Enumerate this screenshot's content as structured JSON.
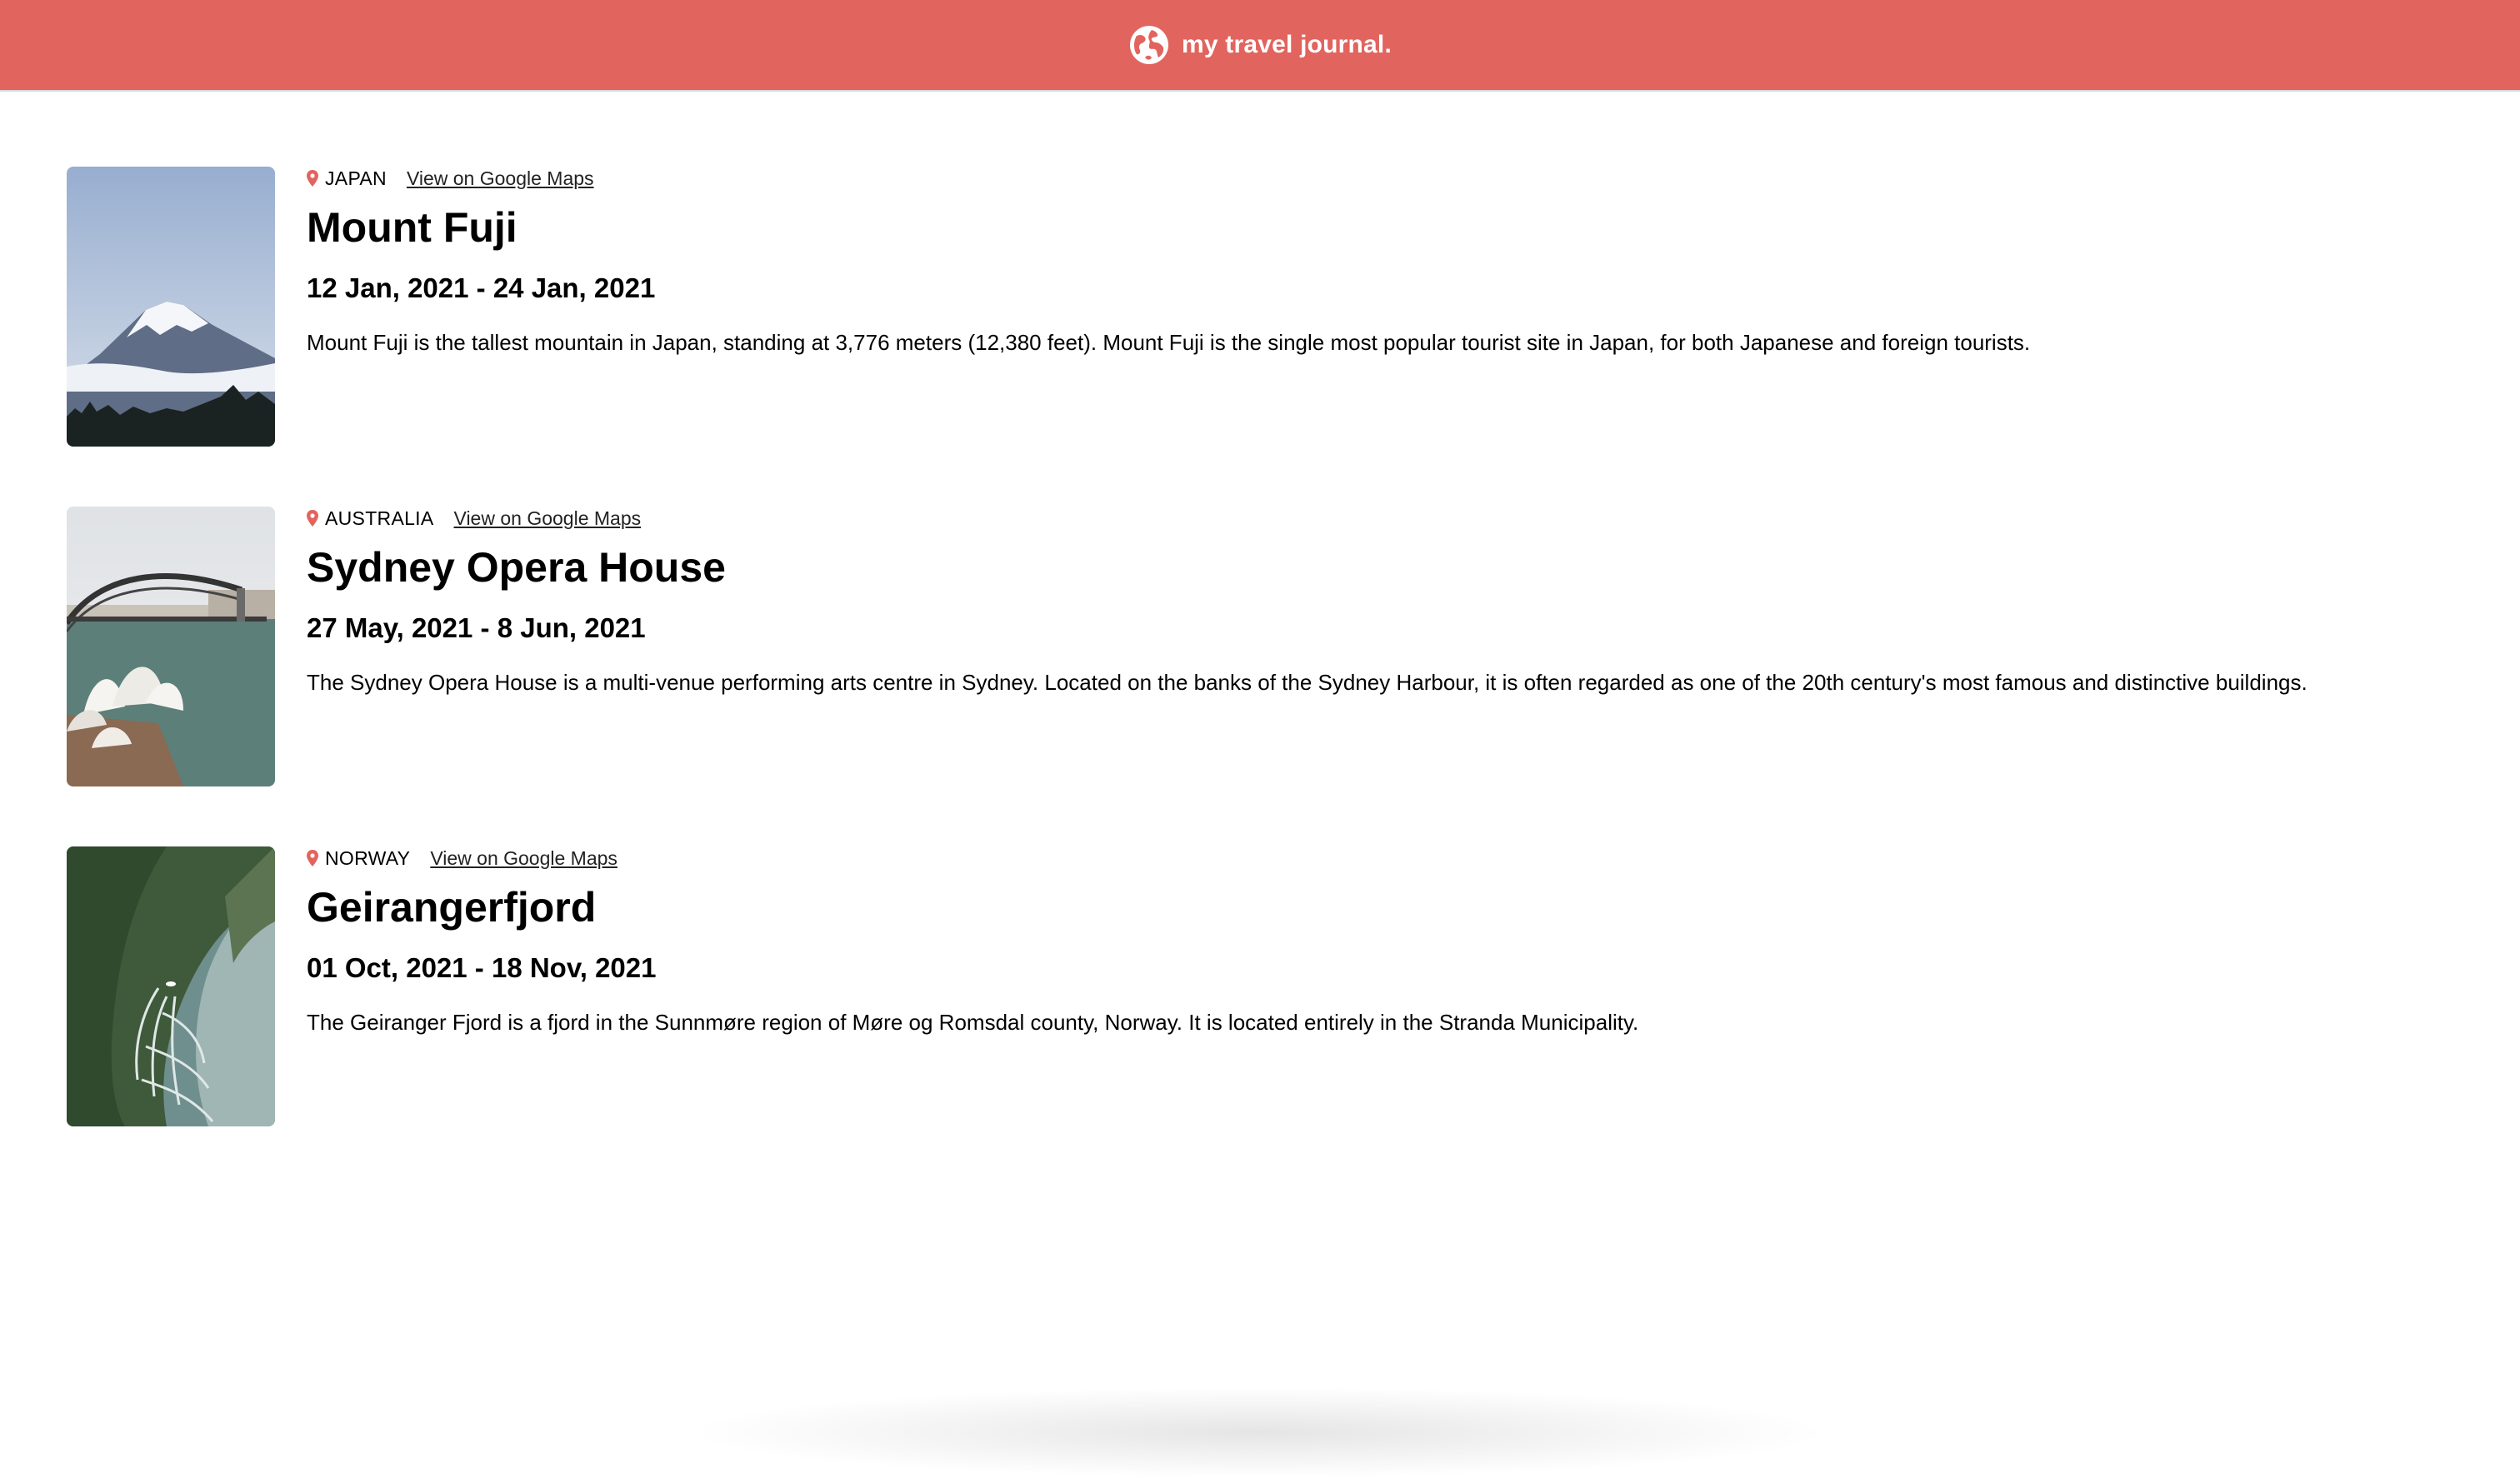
{
  "header": {
    "brand": "my travel journal.",
    "icon": "globe-icon",
    "color": "#E2645E"
  },
  "entries": [
    {
      "country": "JAPAN",
      "map_link": "View on Google Maps",
      "title": "Mount Fuji",
      "dates": "12 Jan, 2021 - 24 Jan, 2021",
      "description": "Mount Fuji is the tallest mountain in Japan, standing at 3,776 meters (12,380 feet). Mount Fuji is the single most popular tourist site in Japan, for both Japanese and foreign tourists."
    },
    {
      "country": "AUSTRALIA",
      "map_link": "View on Google Maps",
      "title": "Sydney Opera House",
      "dates": "27 May, 2021 - 8 Jun, 2021",
      "description": "The Sydney Opera House is a multi-venue performing arts centre in Sydney. Located on the banks of the Sydney Harbour, it is often regarded as one of the 20th century's most famous and distinctive buildings."
    },
    {
      "country": "NORWAY",
      "map_link": "View on Google Maps",
      "title": "Geirangerfjord",
      "dates": "01 Oct, 2021 - 18 Nov, 2021",
      "description": "The Geiranger Fjord is a fjord in the Sunnmøre region of Møre og Romsdal county, Norway. It is located entirely in the Stranda Municipality."
    }
  ],
  "pin_color": "#E2645E"
}
